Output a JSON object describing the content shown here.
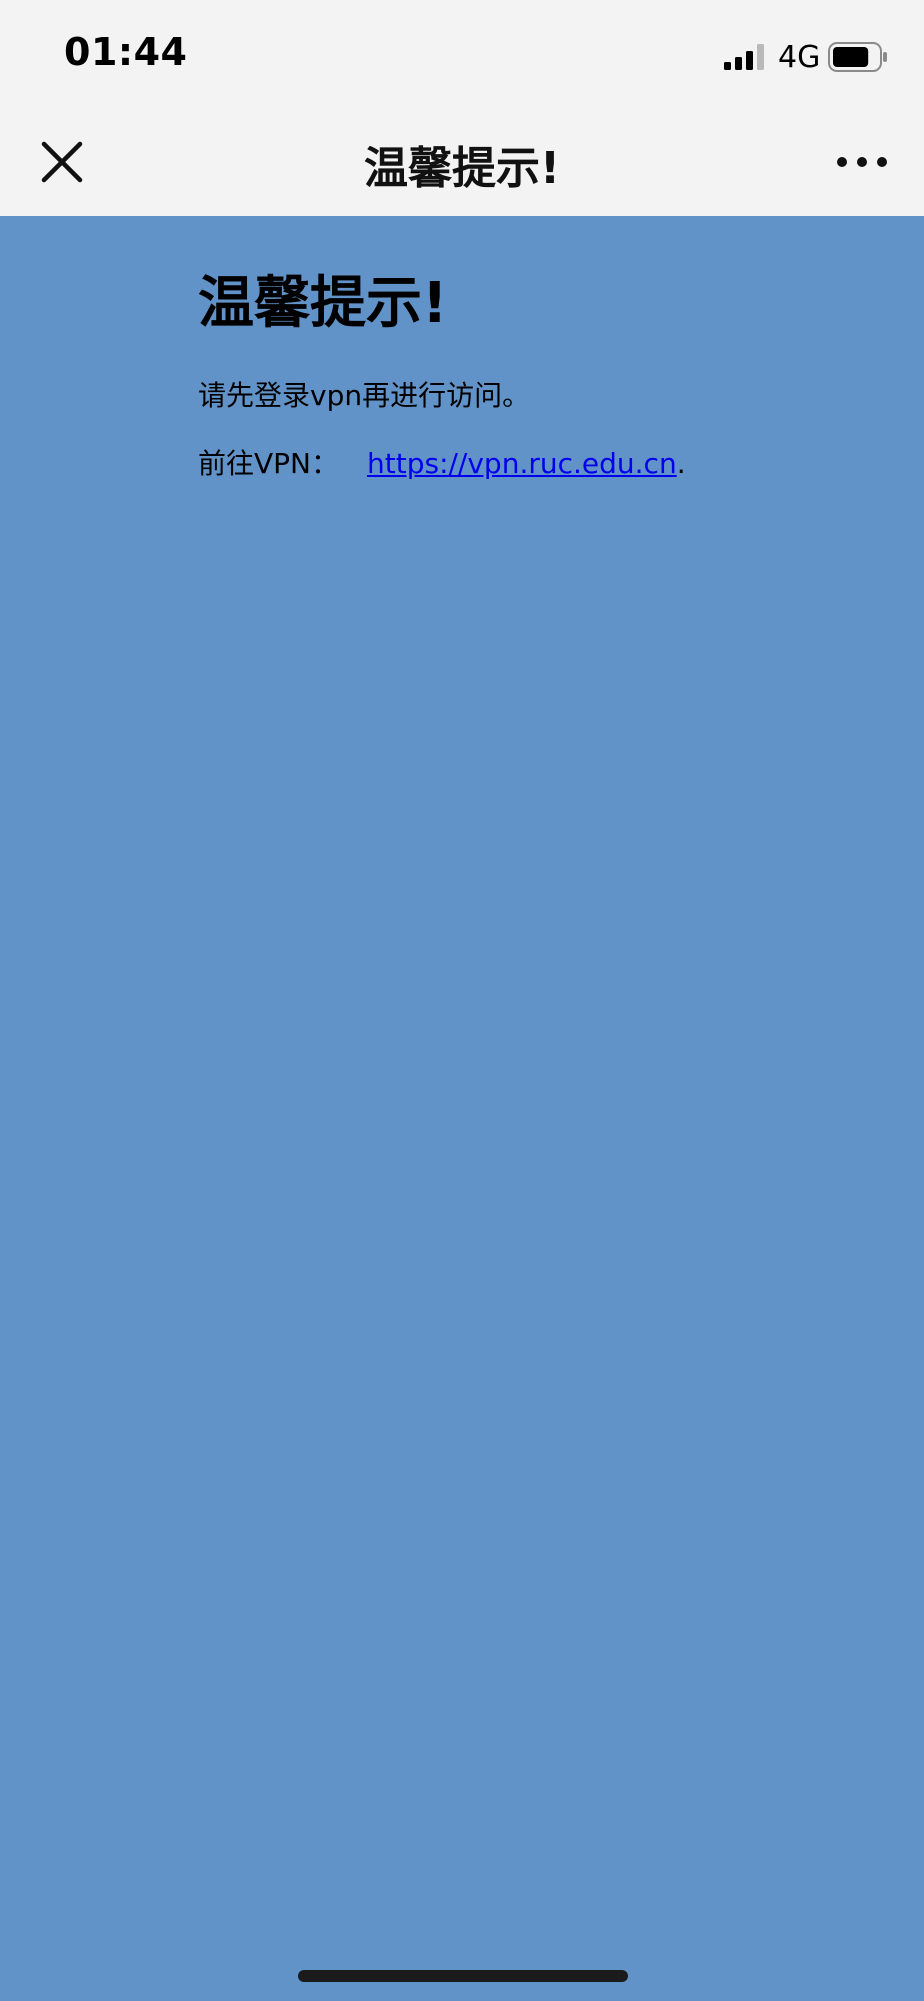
{
  "status_bar": {
    "time": "01:44",
    "network": "4G",
    "signal_icon": "signal-bars-icon",
    "battery_icon": "battery-icon",
    "battery_level": 0.8
  },
  "nav": {
    "title": "温馨提示!",
    "close_icon": "close-icon",
    "more_icon": "more-dots-icon"
  },
  "content": {
    "heading": "温馨提示!",
    "notice": "请先登录vpn再进行访问。",
    "vpn_prefix": "前往VPN：",
    "vpn_link": "https://vpn.ruc.edu.cn",
    "vpn_suffix": "."
  },
  "colors": {
    "background": "#6293c8",
    "bar_background": "#f3f3f3",
    "link": "#0000ee"
  }
}
